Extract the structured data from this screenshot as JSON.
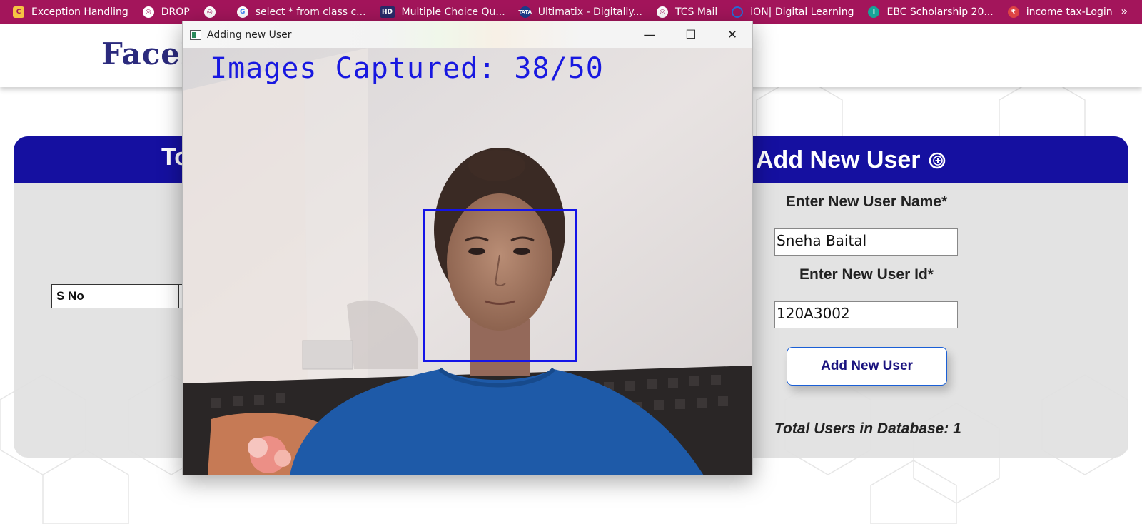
{
  "bookmarks": [
    {
      "label": "Exception Handling",
      "icon": "bookmark-app-icon"
    },
    {
      "label": "DROP",
      "icon": "globe-icon"
    },
    {
      "label": "",
      "icon": "globe-icon"
    },
    {
      "label": "select * from class c...",
      "icon": "google-icon"
    },
    {
      "label": "Multiple Choice Qu...",
      "icon": "hd-icon"
    },
    {
      "label": "Ultimatix - Digitally...",
      "icon": "tata-icon"
    },
    {
      "label": "TCS Mail",
      "icon": "globe-icon"
    },
    {
      "label": "iON| Digital Learning",
      "icon": "ion-icon"
    },
    {
      "label": "EBC Scholarship 20...",
      "icon": "ebc-icon"
    },
    {
      "label": "income tax-Login",
      "icon": "tax-icon"
    }
  ],
  "bookmarks_more": "»",
  "header": {
    "logo": "FaceL"
  },
  "card": {
    "left_title": "To",
    "right_title": "Add New User",
    "table_header": "S No",
    "name_label": "Enter New User Name*",
    "name_value": "Sneha Baital",
    "id_label": "Enter New User Id*",
    "id_value": "120A3002",
    "add_button": "Add New User",
    "total_users": "Total Users in Database: 1"
  },
  "cv_window": {
    "title": "Adding new User",
    "minimize": "—",
    "maximize": "☐",
    "close": "✕",
    "overlay_text": "Images Captured: 38/50"
  },
  "colors": {
    "bookmark_bar": "#a3155b",
    "card_header": "#1510a0",
    "overlay_text": "#1818e0"
  }
}
